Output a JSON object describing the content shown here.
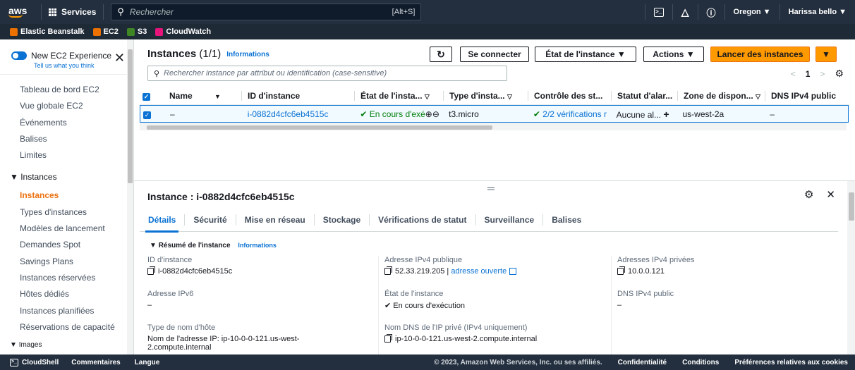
{
  "topnav": {
    "logo": "aws",
    "services": "Services",
    "search_placeholder": "Rechercher",
    "search_shortcut": "[Alt+S]",
    "region": "Oregon ▼",
    "user": "Harissa bello ▼"
  },
  "favorites": [
    {
      "label": "Elastic Beanstalk",
      "color": "#ed7100"
    },
    {
      "label": "EC2",
      "color": "#ed7100"
    },
    {
      "label": "S3",
      "color": "#3f8624"
    },
    {
      "label": "CloudWatch",
      "color": "#e7157b"
    }
  ],
  "sidebar": {
    "new_experience": "New EC2 Experience",
    "tell_us": "Tell us what you think",
    "items_top": [
      "Tableau de bord EC2",
      "Vue globale EC2",
      "Événements",
      "Balises",
      "Limites"
    ],
    "section": "Instances",
    "items_instances": [
      "Instances",
      "Types d'instances",
      "Modèles de lancement",
      "Demandes Spot",
      "Savings Plans",
      "Instances réservées",
      "Hôtes dédiés",
      "Instances planifiées",
      "Réservations de capacité"
    ],
    "section2": "Images"
  },
  "header": {
    "title": "Instances",
    "count": "(1/1)",
    "info": "Informations",
    "connect": "Se connecter",
    "state": "État de l'instance ▼",
    "actions": "Actions ▼",
    "launch": "Lancer des instances",
    "launch_caret": "▼",
    "search_placeholder": "Rechercher instance par attribut ou identification (case-sensitive)",
    "page": "1"
  },
  "table": {
    "columns": [
      "Name",
      "ID d'instance",
      "État de l'insta...",
      "Type d'insta...",
      "Contrôle des st...",
      "Statut d'alar...",
      "Zone de dispon...",
      "DNS IPv4 public"
    ],
    "row": {
      "name": "–",
      "id": "i-0882d4cfc6eb4515c",
      "state": "En cours d'exé",
      "type": "t3.micro",
      "checks": "2/2 vérifications r",
      "alarm": "Aucune al...",
      "zone": "us-west-2a",
      "dns": "–"
    }
  },
  "detail": {
    "title": "Instance : i-0882d4cfc6eb4515c",
    "tabs": [
      "Détails",
      "Sécurité",
      "Mise en réseau",
      "Stockage",
      "Vérifications de statut",
      "Surveillance",
      "Balises"
    ],
    "summary": "Résumé de l'instance",
    "summary_info": "Informations",
    "fields": {
      "id_label": "ID d'instance",
      "id_value": "i-0882d4cfc6eb4515c",
      "ipv6_label": "Adresse IPv6",
      "ipv6_value": "–",
      "hostname_label": "Type de nom d'hôte",
      "hostname_value": "Nom de l'adresse IP: ip-10-0-0-121.us-west-",
      "hostname_value2": "2.compute.internal",
      "pubip_label": "Adresse IPv4 publique",
      "pubip_value": "52.33.219.205",
      "pubip_link": "adresse ouverte",
      "state_label": "État de l'instance",
      "state_value": "En cours d'exécution",
      "privdns_label": "Nom DNS de l'IP privé (IPv4 uniquement)",
      "privdns_value": "ip-10-0-0-121.us-west-2.compute.internal",
      "privip_label": "Adresses IPv4 privées",
      "privip_value": "10.0.0.121",
      "pubdns_label": "DNS IPv4 public",
      "pubdns_value": "–"
    }
  },
  "footer": {
    "cloudshell": "CloudShell",
    "feedback": "Commentaires",
    "language": "Langue",
    "copyright": "© 2023, Amazon Web Services, Inc. ou ses affiliés.",
    "privacy": "Confidentialité",
    "conditions": "Conditions",
    "cookies": "Préférences relatives aux cookies"
  },
  "colors": {
    "accent": "#0972d3",
    "brand": "#ff9900",
    "nav": "#232f3e",
    "success": "#037f0c"
  }
}
